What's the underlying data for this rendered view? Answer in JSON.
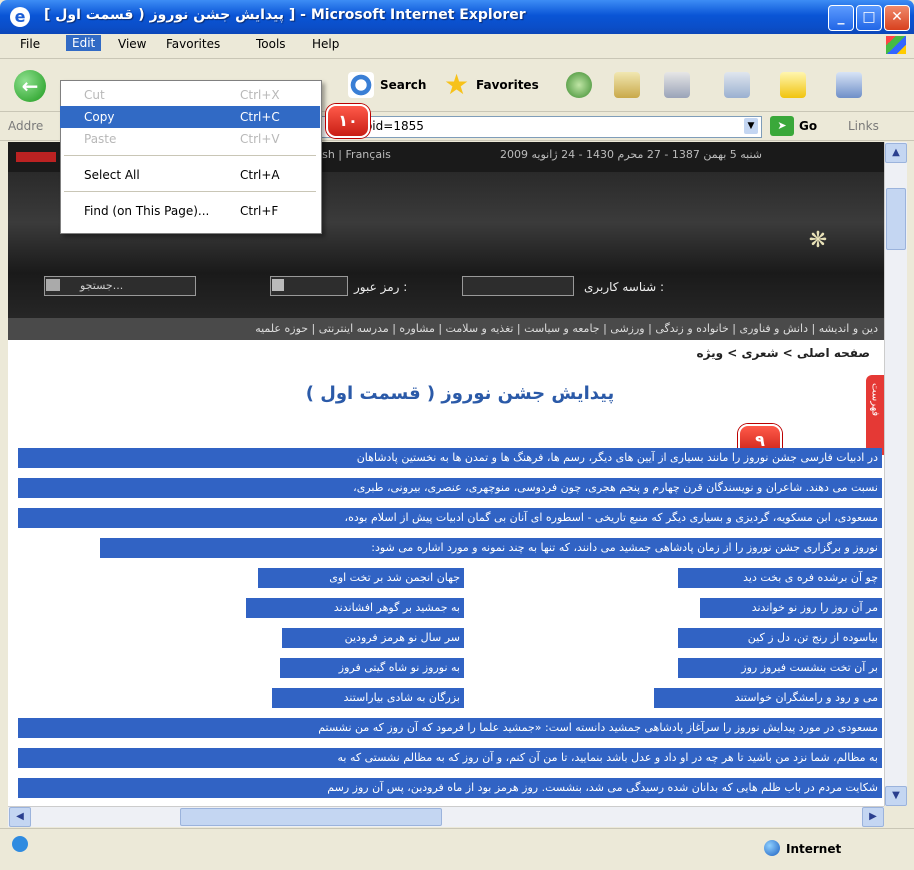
{
  "window": {
    "title": "[ پیدایش جشن نوروز ( قسمت اول ] - Microsoft Internet Explorer",
    "minimize": "_",
    "maximize": "□",
    "close": "✕",
    "app_icon": "e"
  },
  "menubar": {
    "items": [
      "File",
      "Edit",
      "View",
      "Favorites",
      "Tools",
      "Help"
    ]
  },
  "toolbar": {
    "back_icon": "back-arrow-icon",
    "search_label": "Search",
    "favorites_label": "Favorites"
  },
  "address": {
    "label": "Addre",
    "url": "aspx?pid=1855",
    "go_label": "Go",
    "links_label": "Links"
  },
  "edit_menu": {
    "items": [
      {
        "label": "Cut",
        "shortcut": "Ctrl+X",
        "state": "disabled"
      },
      {
        "label": "Copy",
        "shortcut": "Ctrl+C",
        "state": "highlighted"
      },
      {
        "label": "Paste",
        "shortcut": "Ctrl+V",
        "state": "disabled"
      },
      {
        "label": "Select All",
        "shortcut": "Ctrl+A",
        "state": "normal"
      },
      {
        "label": "Find (on This Page)...",
        "shortcut": "Ctrl+F",
        "state": "normal"
      }
    ]
  },
  "site": {
    "languages": "lish | Français",
    "date": "شنبه 5 بهمن 1387 - 27 محرم 1430 - 24 ژانویه 2009",
    "username_label": "شناسه کاربری :",
    "password_label": "رمز عبور :",
    "search_placeholder": "جستجو...",
    "nav_strip": "دین و اندیشه | دانش و فناوری | خانواده و زندگی | ورزشی | جامعه و سیاست | تغذیه و سلامت | مشاوره | مدرسه اینترنتی | حوزه علمیه",
    "breadcrumb": "صفحه اصلی > شعری > ویژه",
    "article_title": "پیدایش جشن نوروز ( قسمت اول )",
    "side_tab": "فهرست"
  },
  "badges": {
    "badge_10": "۱۰",
    "badge_9": "۹"
  },
  "article": {
    "full_lines": [
      "در ادبیات فارسی جشن نوروز را مانند بسیاری از آیین های دیگر، رسم ها، فرهنگ ها و تمدن ها به نخستین پادشاهان",
      "نسبت می دهند. شاعران و نویسندگان قرن چهارم و پنجم هجری، چون فردوسی، منوچهری، عنصری، بیرونی، طبری،",
      "مسعودی، ابن مسکویه، گردیزی و بسیاری دیگر که منبع تاریخی - اسطوره ای آنان بی گمان ادبیات پیش از اسلام بوده،",
      "نوروز و برگزاری جشن نوروز را از زمان پادشاهی جمشید می دانند، که تنها به چند نمونه و مورد اشاره می شود:"
    ],
    "verses_right": [
      "چو آن برشده فره ی بخت دید",
      "مر آن روز را روز نو خواندند",
      "بیاسوده از رنج تن، دل ز کین",
      "بر آن تخت بنشست فیروز روز",
      "می و رود و رامشگران خواستند"
    ],
    "verses_left": [
      "جهان انجمن شد بر تخت اوی",
      "به جمشید بر گوهر افشاندند",
      "سر سال نو هرمز فرودین",
      "به نوروز نو شاه گیتی فروز",
      "بزرگان به شادی بیاراستند"
    ],
    "lower_lines": [
      "مسعودی در مورد پیدایش نوروز را سرآغاز پادشاهی جمشید دانسته است: «جمشید علما را فرمود که آن روز که من نشستم",
      "به مظالم، شما نزد من باشید تا هر چه در او داد و عدل باشد بنمایید، تا من آن کنم، و آن روز که به مظالم نشستی که به",
      "شکایت مردم در باب ظلم هایی که بدانان شده رسیدگی می شد، بنشست. روز هرمز بود از ماه فرودین، پس آن روز رسم"
    ]
  },
  "status": {
    "zone": "Internet"
  }
}
